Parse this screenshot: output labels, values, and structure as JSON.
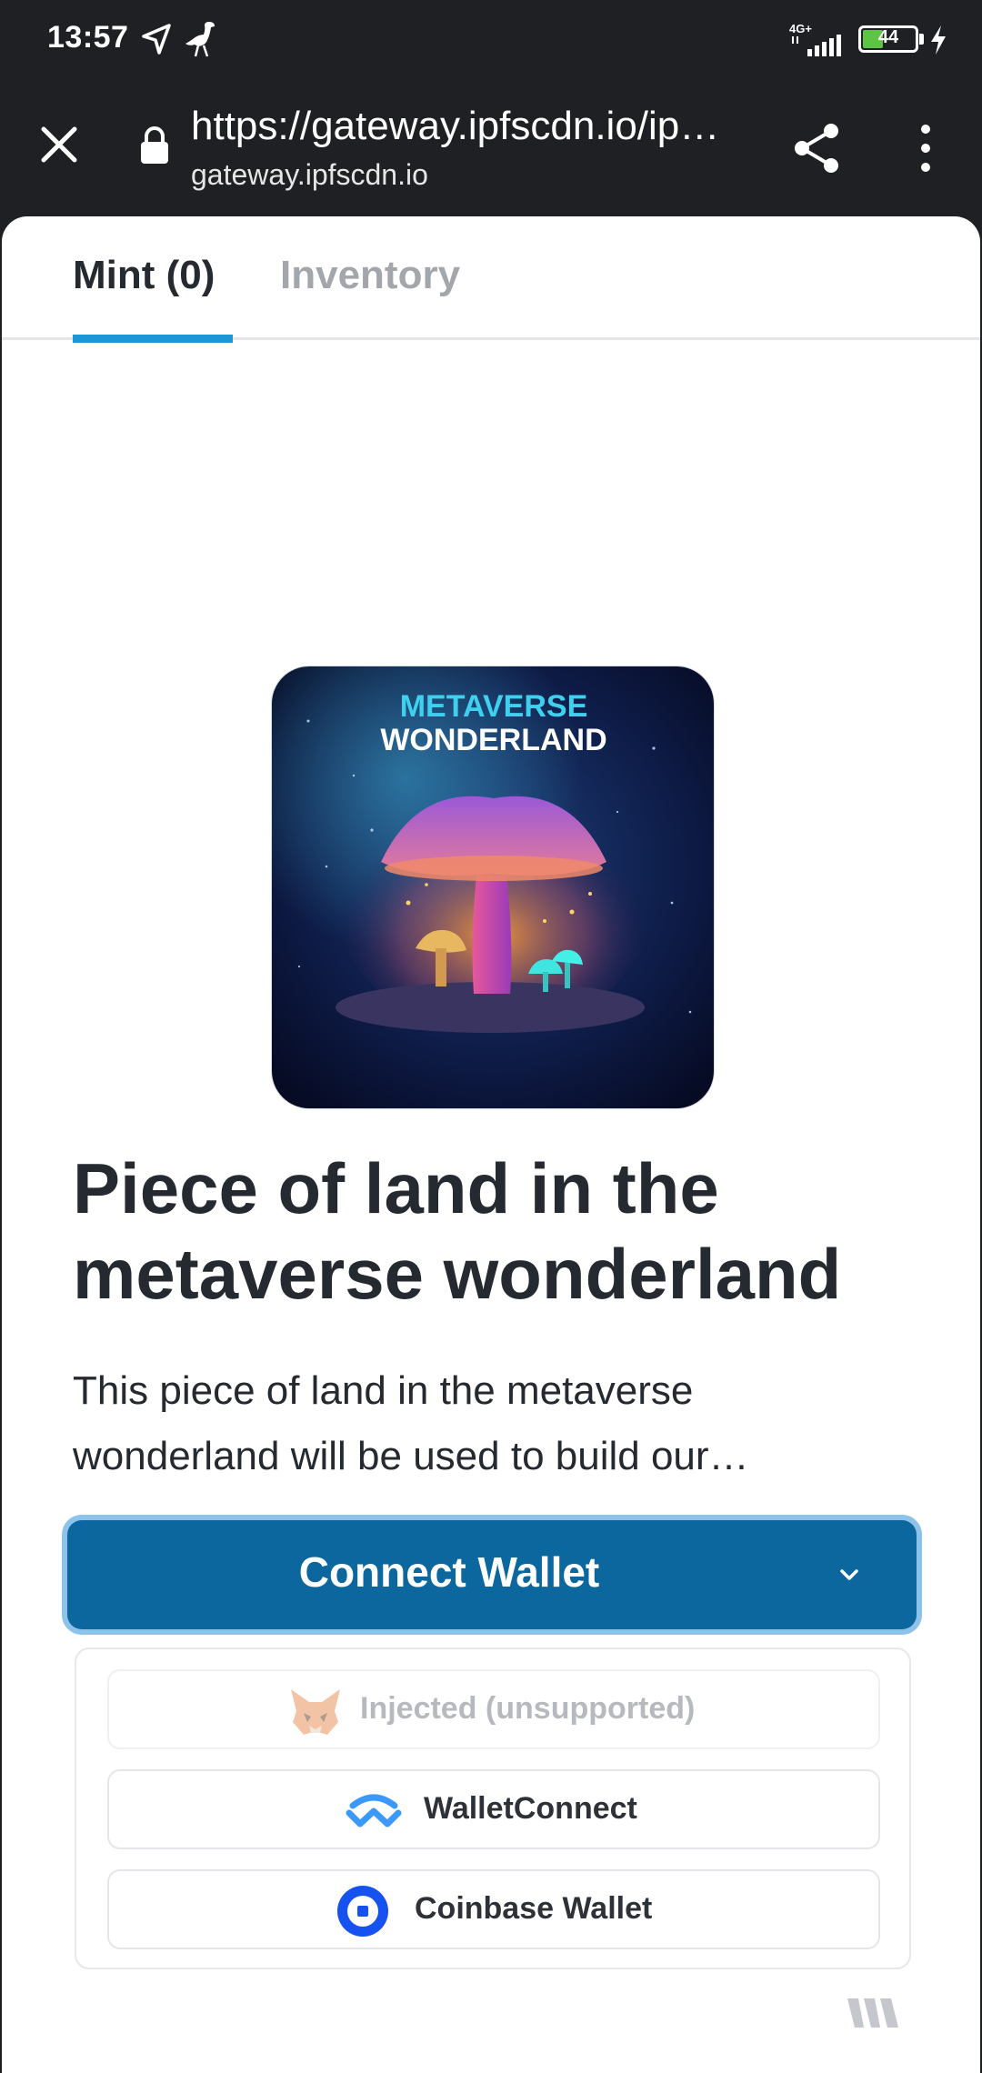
{
  "status_bar": {
    "time": "13:57",
    "network": "4G+",
    "battery": "44",
    "battery_level": 0.44
  },
  "browser": {
    "url": "https://gateway.ipfscdn.io/ip…",
    "domain": "gateway.ipfscdn.io"
  },
  "tabs": [
    {
      "label": "Mint (0)",
      "active": true
    },
    {
      "label": "Inventory",
      "active": false
    }
  ],
  "nft": {
    "image_text_line1": "METAVERSE",
    "image_text_line2": "WONDERLAND",
    "title": "Piece of land in the metaverse wonderland",
    "description": "This piece of land in the metaverse wonderland will be used to build our…"
  },
  "connect": {
    "label": "Connect Wallet"
  },
  "wallets": [
    {
      "label": "Injected (unsupported)",
      "icon": "metamask-icon",
      "disabled": true
    },
    {
      "label": "WalletConnect",
      "icon": "walletconnect-icon",
      "disabled": false
    },
    {
      "label": "Coinbase Wallet",
      "icon": "coinbase-icon",
      "disabled": false
    }
  ],
  "colors": {
    "accent": "#1b97d8",
    "button": "#0b679e",
    "button_ring": "#8dc2ea",
    "text": "#252930"
  }
}
